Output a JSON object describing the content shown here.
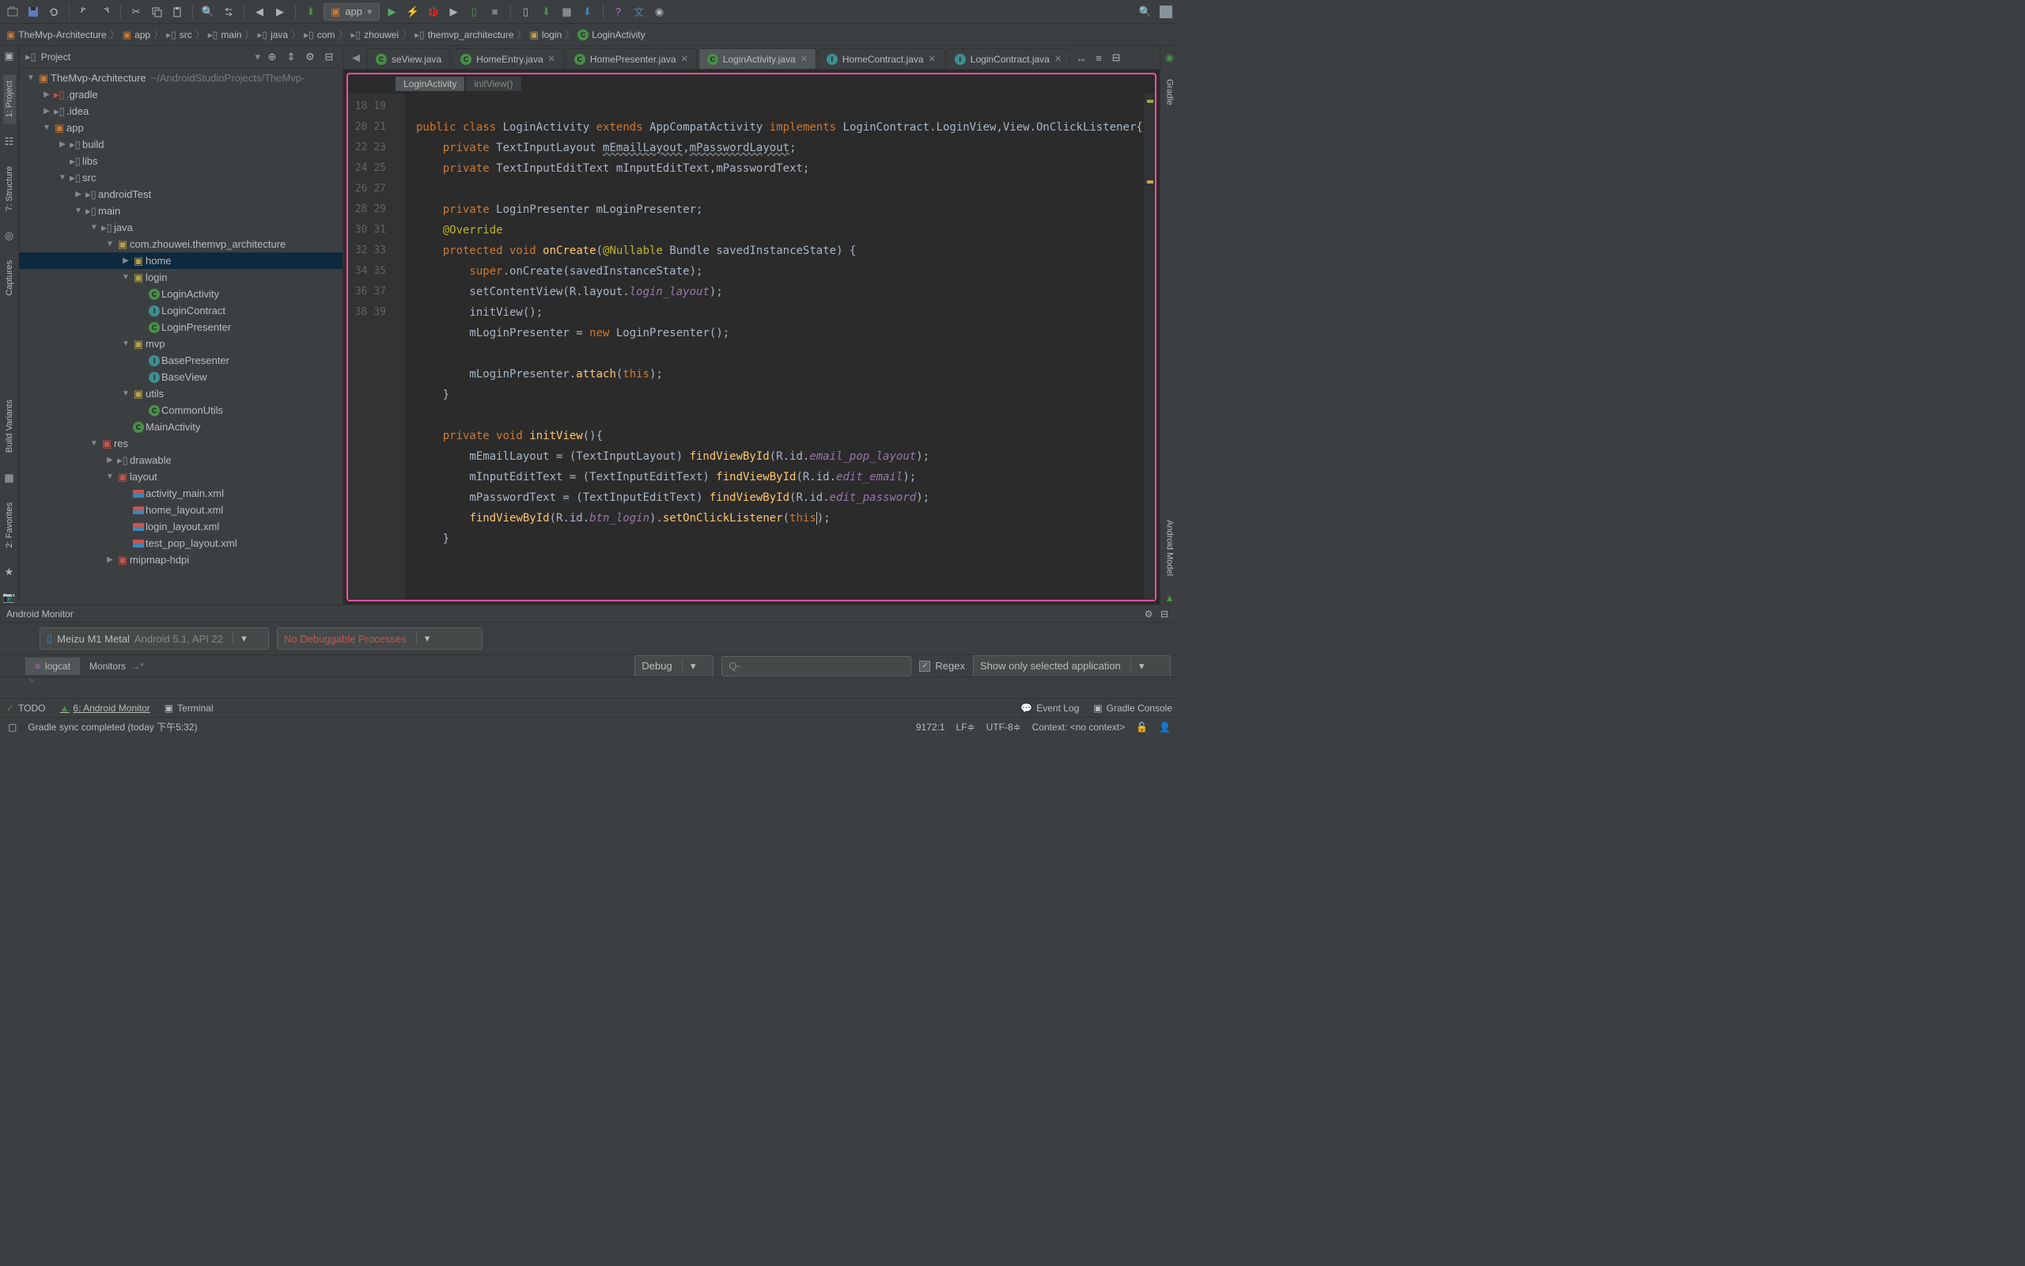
{
  "toolbar": {
    "run_config": "app"
  },
  "breadcrumb": [
    {
      "icon": "module",
      "label": "TheMvp-Architecture"
    },
    {
      "icon": "module",
      "label": "app"
    },
    {
      "icon": "folder",
      "label": "src"
    },
    {
      "icon": "folder",
      "label": "main"
    },
    {
      "icon": "folder",
      "label": "java"
    },
    {
      "icon": "folder",
      "label": "com"
    },
    {
      "icon": "folder",
      "label": "zhouwei"
    },
    {
      "icon": "folder",
      "label": "themvp_architecture"
    },
    {
      "icon": "package",
      "label": "login"
    },
    {
      "icon": "class",
      "label": "LoginActivity"
    }
  ],
  "projectPanel": {
    "title": "Project"
  },
  "tree": [
    {
      "depth": 0,
      "arrow": "▼",
      "icon": "module",
      "label": "TheMvp-Architecture",
      "hint": "~/AndroidStudioProjects/TheMvp-"
    },
    {
      "depth": 1,
      "arrow": "▶",
      "icon": "folder-config",
      "label": ".gradle"
    },
    {
      "depth": 1,
      "arrow": "▶",
      "icon": "folder-gray",
      "label": ".idea"
    },
    {
      "depth": 1,
      "arrow": "▼",
      "icon": "module",
      "label": "app"
    },
    {
      "depth": 2,
      "arrow": "▶",
      "icon": "folder-gray",
      "label": "build"
    },
    {
      "depth": 2,
      "arrow": "",
      "icon": "folder-gray",
      "label": "libs"
    },
    {
      "depth": 2,
      "arrow": "▼",
      "icon": "folder-gray",
      "label": "src"
    },
    {
      "depth": 3,
      "arrow": "▶",
      "icon": "folder-gray",
      "label": "androidTest"
    },
    {
      "depth": 3,
      "arrow": "▼",
      "icon": "folder-gray",
      "label": "main"
    },
    {
      "depth": 4,
      "arrow": "▼",
      "icon": "folder-gray",
      "label": "java"
    },
    {
      "depth": 5,
      "arrow": "▼",
      "icon": "package",
      "label": "com.zhouwei.themvp_architecture"
    },
    {
      "depth": 6,
      "arrow": "▶",
      "icon": "package",
      "label": "home",
      "selected": true
    },
    {
      "depth": 6,
      "arrow": "▼",
      "icon": "package",
      "label": "login"
    },
    {
      "depth": 7,
      "arrow": "",
      "icon": "class",
      "label": "LoginActivity"
    },
    {
      "depth": 7,
      "arrow": "",
      "icon": "interface",
      "label": "LoginContract"
    },
    {
      "depth": 7,
      "arrow": "",
      "icon": "class",
      "label": "LoginPresenter"
    },
    {
      "depth": 6,
      "arrow": "▼",
      "icon": "package",
      "label": "mvp"
    },
    {
      "depth": 7,
      "arrow": "",
      "icon": "interface",
      "label": "BasePresenter"
    },
    {
      "depth": 7,
      "arrow": "",
      "icon": "interface",
      "label": "BaseView"
    },
    {
      "depth": 6,
      "arrow": "▼",
      "icon": "package",
      "label": "utils"
    },
    {
      "depth": 7,
      "arrow": "",
      "icon": "class",
      "label": "CommonUtils"
    },
    {
      "depth": 6,
      "arrow": "",
      "icon": "class",
      "label": "MainActivity"
    },
    {
      "depth": 4,
      "arrow": "▼",
      "icon": "res",
      "label": "res"
    },
    {
      "depth": 5,
      "arrow": "▶",
      "icon": "folder-gray",
      "label": "drawable"
    },
    {
      "depth": 5,
      "arrow": "▼",
      "icon": "res",
      "label": "layout"
    },
    {
      "depth": 6,
      "arrow": "",
      "icon": "xml",
      "label": "activity_main.xml"
    },
    {
      "depth": 6,
      "arrow": "",
      "icon": "xml",
      "label": "home_layout.xml"
    },
    {
      "depth": 6,
      "arrow": "",
      "icon": "xml",
      "label": "login_layout.xml"
    },
    {
      "depth": 6,
      "arrow": "",
      "icon": "xml",
      "label": "test_pop_layout.xml"
    },
    {
      "depth": 5,
      "arrow": "▶",
      "icon": "res",
      "label": "mipmap-hdpi"
    }
  ],
  "tabs": [
    {
      "icon": "class",
      "label": "seView.java",
      "close": false
    },
    {
      "icon": "class",
      "label": "HomeEntry.java",
      "close": true
    },
    {
      "icon": "class",
      "label": "HomePresenter.java",
      "close": true
    },
    {
      "icon": "class",
      "label": "LoginActivity.java",
      "close": true,
      "active": true
    },
    {
      "icon": "interface",
      "label": "HomeContract.java",
      "close": true
    },
    {
      "icon": "interface",
      "label": "LoginContract.java",
      "close": true
    }
  ],
  "editorCrumb": {
    "cls": "LoginActivity",
    "method": "initView()"
  },
  "gutterStart": 18,
  "code": [
    "",
    "<kw>public class</kw> <type>LoginActivity</type> <kw>extends</kw> <type>AppCompatActivity</type> <kw>implements</kw> <type>LoginContract.LoginView</type>,<type>View.OnClickListener</type>{",
    "    <kw>private</kw> <type>TextInputLayout</type> <under>mEmailLayout</under>,<under>mPasswordLayout</under>;",
    "    <kw>private</kw> <type>TextInputEditText</type> mInputEditText,mPasswordText;",
    "",
    "    <kw>private</kw> <type>LoginPresenter</type> mLoginPresenter;",
    "    <ann>@Override</ann>",
    "    <kw>protected void</kw> <fn>onCreate</fn>(<ann>@Nullable</ann> <type>Bundle</type> savedInstanceState) {",
    "        <kw>super</kw>.onCreate(savedInstanceState);",
    "        setContentView(R.layout.<field>login_layout</field>);",
    "        initView();",
    "        mLoginPresenter = <kw>new</kw> LoginPresenter();",
    "",
    "        mLoginPresenter.<fn>attach</fn>(<kw>this</kw>);",
    "    }",
    "",
    "    <kw>private void</kw> <fn>initView</fn>(){",
    "        mEmailLayout = (TextInputLayout) <fn>findViewById</fn>(R.id.<field>email_pop_layout</field>);",
    "        mInputEditText = (TextInputEditText) <fn>findViewById</fn>(R.id.<field>edit_email</field>);",
    "        mPasswordText = (TextInputEditText) <fn>findViewById</fn>(R.id.<field>edit_password</field>);",
    "        <fn>findViewById</fn>(R.id.<field>btn_login</field>).<fn>setOnClickListener</fn>(<kw>this</kw><caret></caret>);",
    "    }"
  ],
  "androidMonitor": {
    "title": "Android Monitor",
    "device": "Meizu M1 Metal",
    "deviceDetail": "Android 5.1, API 22",
    "process": "No Debuggable Processes",
    "tabs": {
      "logcat": "logcat",
      "monitors": "Monitors"
    },
    "level": "Debug",
    "searchPlaceholder": "Q-",
    "regex": "Regex",
    "filter": "Show only selected application"
  },
  "statusTabs": {
    "todo": "TODO",
    "monitor": "6: Android Monitor",
    "terminal": "Terminal",
    "eventlog": "Event Log",
    "gradleconsole": "Gradle Console"
  },
  "statusbar": {
    "msg": "Gradle sync completed (today 下午5:32)",
    "pos": "9172:1",
    "lineend": "LF≑",
    "encoding": "UTF-8≑",
    "context": "Context: <no context>"
  },
  "leftRail": [
    "1: Project",
    "7: Structure",
    "Captures",
    "Build Variants",
    "2: Favorites"
  ],
  "rightRail": [
    "Gradle",
    "Android Model"
  ]
}
